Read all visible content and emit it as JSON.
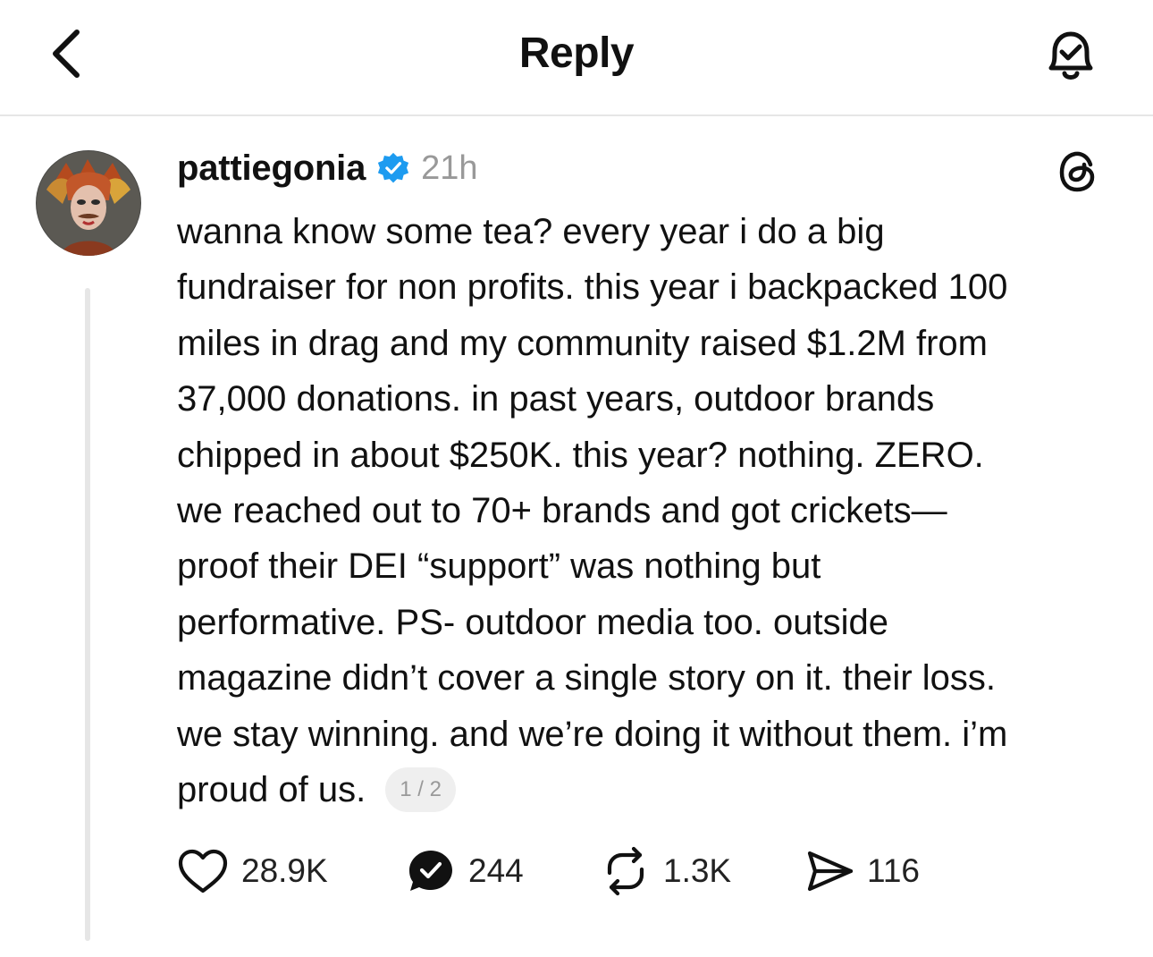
{
  "header": {
    "title": "Reply",
    "back_icon": "chevron-left-icon",
    "bell_icon": "bell-check-icon"
  },
  "post": {
    "username": "pattiegonia",
    "verified": true,
    "timestamp": "21h",
    "lines": [
      "wanna know some tea? every year i do a big",
      "fundraiser for non profits. this year i backpacked 100",
      "miles in drag and my community raised $1.2M from",
      "37,000 donations. in past years, outdoor brands",
      "chipped in about $250K. this year? nothing. ZERO.",
      "we reached out to 70+ brands and got crickets—",
      "proof their DEI “support” was nothing but",
      "performative. PS- outdoor media too. outside",
      "magazine didn’t cover a single story on it. their loss.",
      "we stay winning. and we’re doing it without them. i’m",
      "proud of us."
    ],
    "page_indicator": "1 / 2",
    "actions": {
      "likes": "28.9K",
      "replies": "244",
      "reposts": "1.3K",
      "shares": "116"
    }
  },
  "colors": {
    "text": "#111111",
    "muted": "#999999",
    "verified": "#1d9bf0",
    "divider": "#e6e6e6"
  }
}
